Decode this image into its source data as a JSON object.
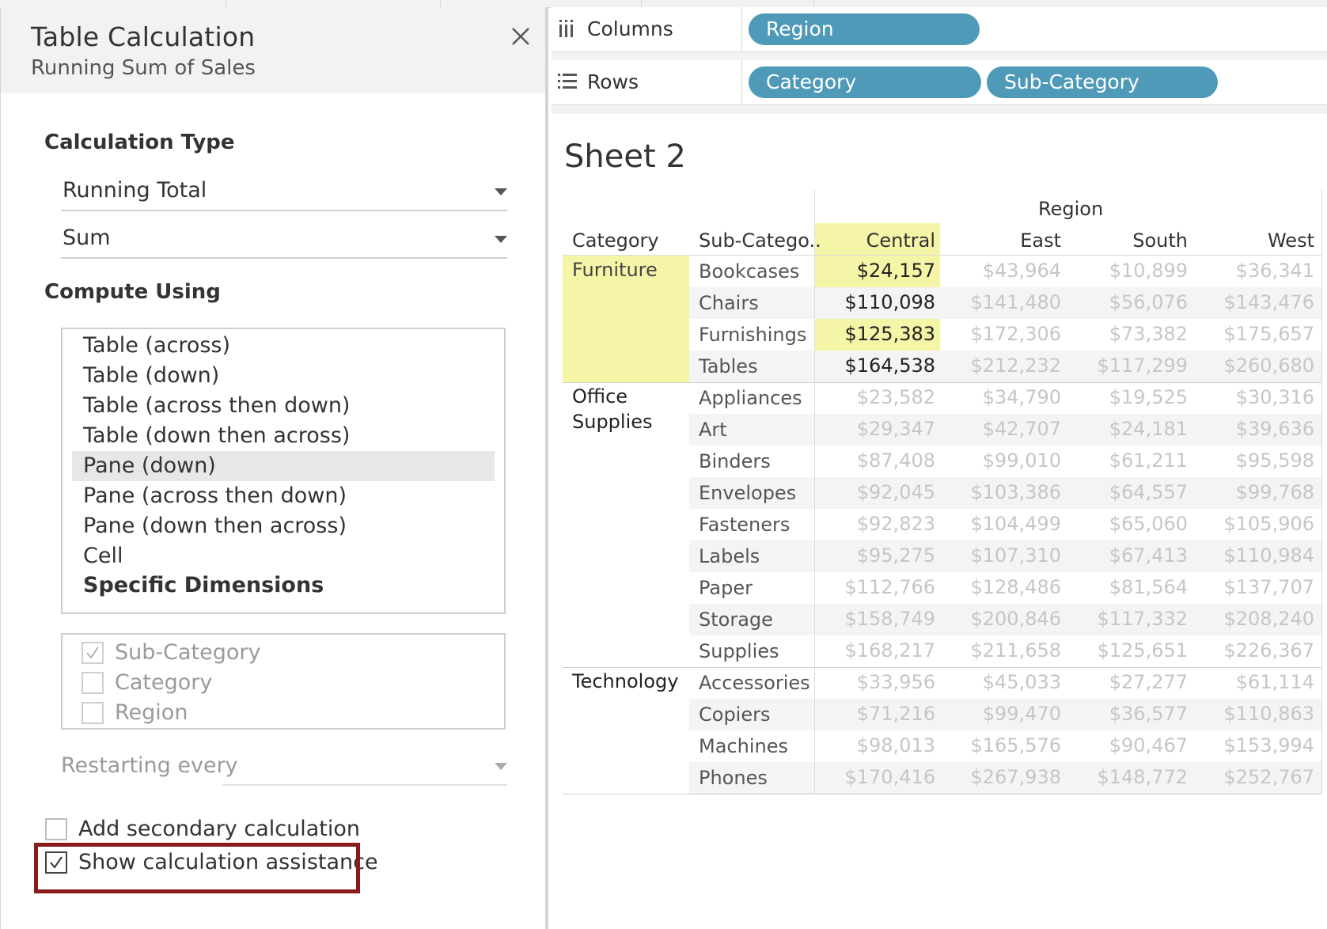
{
  "dialog": {
    "title": "Table Calculation",
    "subtitle": "Running Sum of Sales",
    "calculation_type_heading": "Calculation Type",
    "calculation_type_value": "Running Total",
    "aggregation_value": "Sum",
    "compute_using_heading": "Compute Using",
    "compute_using_options": [
      "Table (across)",
      "Table (down)",
      "Table (across then down)",
      "Table (down then across)",
      "Pane (down)",
      "Pane (across then down)",
      "Pane (down then across)",
      "Cell",
      "Specific Dimensions"
    ],
    "compute_using_selected": "Pane (down)",
    "specific_dimensions": [
      {
        "label": "Sub-Category",
        "checked": true
      },
      {
        "label": "Category",
        "checked": false
      },
      {
        "label": "Region",
        "checked": false
      }
    ],
    "restarting_every_label": "Restarting every",
    "restarting_every_value": "",
    "add_secondary_label": "Add secondary calculation",
    "add_secondary_checked": false,
    "show_assistance_label": "Show calculation assistance",
    "show_assistance_checked": true
  },
  "shelves": {
    "columns_label": "Columns",
    "columns_pills": [
      "Region"
    ],
    "rows_label": "Rows",
    "rows_pills": [
      "Category",
      "Sub-Category"
    ]
  },
  "sheet": {
    "title": "Sheet 2",
    "column_group_header": "Region",
    "row_header_category": "Category",
    "row_header_subcategory": "Sub-Catego..",
    "regions": [
      "Central",
      "East",
      "South",
      "West"
    ],
    "groups": [
      {
        "category": "Furniture",
        "rows": [
          {
            "sub": "Bookcases",
            "values": [
              "$24,157",
              "$43,964",
              "$10,899",
              "$36,341"
            ]
          },
          {
            "sub": "Chairs",
            "values": [
              "$110,098",
              "$141,480",
              "$56,076",
              "$143,476"
            ]
          },
          {
            "sub": "Furnishings",
            "values": [
              "$125,383",
              "$172,306",
              "$73,382",
              "$175,657"
            ]
          },
          {
            "sub": "Tables",
            "values": [
              "$164,538",
              "$212,232",
              "$117,299",
              "$260,680"
            ]
          }
        ]
      },
      {
        "category": "Office Supplies",
        "rows": [
          {
            "sub": "Appliances",
            "values": [
              "$23,582",
              "$34,790",
              "$19,525",
              "$30,316"
            ]
          },
          {
            "sub": "Art",
            "values": [
              "$29,347",
              "$42,707",
              "$24,181",
              "$39,636"
            ]
          },
          {
            "sub": "Binders",
            "values": [
              "$87,408",
              "$99,010",
              "$61,211",
              "$95,598"
            ]
          },
          {
            "sub": "Envelopes",
            "values": [
              "$92,045",
              "$103,386",
              "$64,557",
              "$99,768"
            ]
          },
          {
            "sub": "Fasteners",
            "values": [
              "$92,823",
              "$104,499",
              "$65,060",
              "$105,906"
            ]
          },
          {
            "sub": "Labels",
            "values": [
              "$95,275",
              "$107,310",
              "$67,413",
              "$110,984"
            ]
          },
          {
            "sub": "Paper",
            "values": [
              "$112,766",
              "$128,486",
              "$81,564",
              "$137,707"
            ]
          },
          {
            "sub": "Storage",
            "values": [
              "$158,749",
              "$200,846",
              "$117,332",
              "$208,240"
            ]
          },
          {
            "sub": "Supplies",
            "values": [
              "$168,217",
              "$211,658",
              "$125,651",
              "$226,367"
            ]
          }
        ]
      },
      {
        "category": "Technology",
        "rows": [
          {
            "sub": "Accessories",
            "values": [
              "$33,956",
              "$45,033",
              "$27,277",
              "$61,114"
            ]
          },
          {
            "sub": "Copiers",
            "values": [
              "$71,216",
              "$99,470",
              "$36,577",
              "$110,863"
            ]
          },
          {
            "sub": "Machines",
            "values": [
              "$98,013",
              "$165,576",
              "$90,467",
              "$153,994"
            ]
          },
          {
            "sub": "Phones",
            "values": [
              "$170,416",
              "$267,938",
              "$148,772",
              "$252,767"
            ]
          }
        ]
      }
    ],
    "highlight_color": "#f5f5a8",
    "pill_color": "#4f9ab8"
  }
}
